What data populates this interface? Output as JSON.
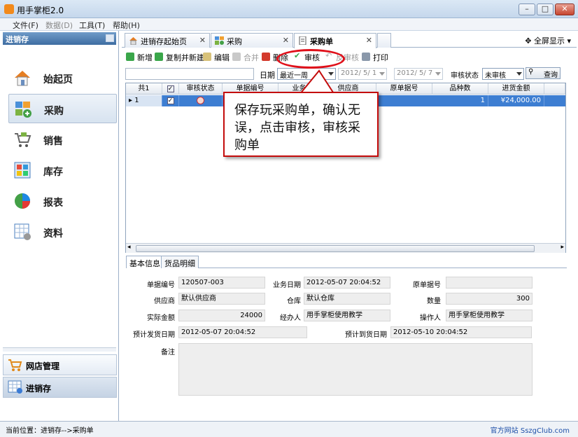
{
  "window": {
    "title": "用手掌柜2.0"
  },
  "menu": [
    "文件(F)",
    "数据(D)",
    "工具(T)",
    "帮助(H)"
  ],
  "sidebar": {
    "header": "进销存",
    "items": [
      "始起页",
      "采购",
      "销售",
      "库存",
      "报表",
      "资料"
    ],
    "bottom": [
      "网店管理",
      "进销存"
    ]
  },
  "tabs": [
    "进销存起始页",
    "采购",
    "采购单"
  ],
  "fullscreen": "全屏显示",
  "toolbar": [
    "新增",
    "复制并新建",
    "编辑",
    "合并",
    "删除",
    "审核",
    "反审核",
    "打印"
  ],
  "filter": {
    "date_label": "日期",
    "date_range": "最近一周",
    "start": "2012/ 5/ 1",
    "end": "2012/ 5/ 7",
    "status_label": "审核状态",
    "status": "未审核",
    "query": "查询"
  },
  "grid": {
    "headers": [
      "共1",
      "",
      "审核状态",
      "单据编号",
      "业务",
      "供应商",
      "原单据号",
      "品种数",
      "进货金额"
    ],
    "row": [
      "1",
      "",
      "",
      "",
      "",
      "",
      "",
      "1",
      "¥24,000.00"
    ]
  },
  "callout": "保存玩采购单，确认无误，点击审核，审核采购单",
  "detail_tabs": [
    "基本信息",
    "货品明细"
  ],
  "detail": {
    "bill_no_label": "单据编号",
    "bill_no": "120507-003",
    "biz_date_label": "业务日期",
    "biz_date": "2012-05-07 20:04:52",
    "orig_no_label": "原单据号",
    "orig_no": "",
    "supplier_label": "供应商",
    "supplier": "默认供应商",
    "warehouse_label": "仓库",
    "warehouse": "默认仓库",
    "qty_label": "数量",
    "qty": "300",
    "amount_label": "实际金额",
    "amount": "24000",
    "handler_label": "经办人",
    "handler": "用手掌柜使用教学",
    "operator_label": "操作人",
    "operator": "用手掌柜使用教学",
    "ship_label": "预计发货日期",
    "ship": "2012-05-07 20:04:52",
    "arrive_label": "预计到货日期",
    "arrive": "2012-05-10 20:04:52",
    "note_label": "备注"
  },
  "status": {
    "left": "当前位置：进销存-->采购单",
    "right": "官方网站 SszgClub.com"
  }
}
